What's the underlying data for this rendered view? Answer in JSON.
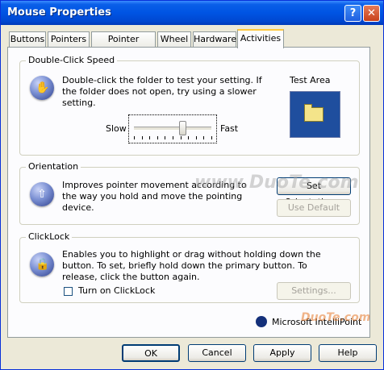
{
  "window": {
    "title": "Mouse Properties",
    "help_button": "?",
    "close_button": "✕"
  },
  "tabs": [
    {
      "label": "Buttons"
    },
    {
      "label": "Pointers"
    },
    {
      "label": "Pointer Options"
    },
    {
      "label": "Wheel"
    },
    {
      "label": "Hardware"
    },
    {
      "label": "Activities"
    }
  ],
  "active_tab": "Activities",
  "double_click": {
    "legend": "Double-Click Speed",
    "description": "Double-click the folder to test your setting. If the folder does not open, try using a slower setting.",
    "test_area_label": "Test Area",
    "slow_label": "Slow",
    "fast_label": "Fast",
    "speed_fraction": 0.62
  },
  "orientation": {
    "legend": "Orientation",
    "description": "Improves pointer movement according to the way you hold and move the pointing device.",
    "set_button": "Set Orientation...",
    "default_button": "Use Default"
  },
  "clicklock": {
    "legend": "ClickLock",
    "description": "Enables you to highlight or drag without holding down the button. To set, briefly hold down the primary button. To release, click the button again.",
    "checkbox_label": "Turn on ClickLock",
    "checked": false,
    "settings_button": "Settings..."
  },
  "branding": {
    "text": "Microsoft IntelliPoint"
  },
  "footer": {
    "ok": "OK",
    "cancel": "Cancel",
    "apply": "Apply",
    "help": "Help"
  },
  "watermark": {
    "text": "www.DuoTe.com"
  },
  "watermark_cn": {
    "text": "DuoTe.com"
  }
}
